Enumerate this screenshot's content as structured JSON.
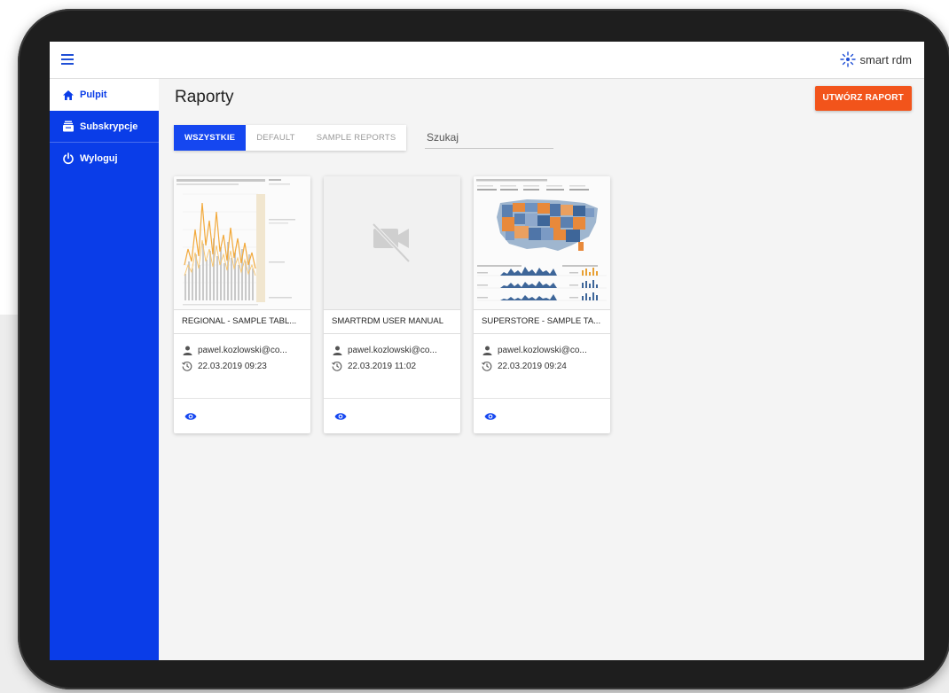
{
  "app": {
    "logo_text": "smart rdm",
    "accent": "#0a3de8",
    "create_color": "#f2541b"
  },
  "sidebar": {
    "items": [
      {
        "label": "Pulpit",
        "icon": "home-icon"
      },
      {
        "label": "Subskrypcje",
        "icon": "subscriptions-icon"
      },
      {
        "label": "Wyloguj",
        "icon": "power-icon"
      }
    ]
  },
  "main": {
    "title": "Raporty",
    "create_label": "UTWÓRZ RAPORT",
    "tabs": [
      {
        "label": "WSZYSTKIE"
      },
      {
        "label": "DEFAULT"
      },
      {
        "label": "SAMPLE REPORTS"
      }
    ],
    "search_placeholder": "Szukaj"
  },
  "cards": [
    {
      "title": "REGIONAL - SAMPLE TABL...",
      "author": "pawel.kozlowski@co...",
      "date": "22.03.2019 09:23",
      "thumb": "line-chart-thumbnail"
    },
    {
      "title": "SMARTRDM USER MANUAL",
      "author": "pawel.kozlowski@co...",
      "date": "22.03.2019 11:02",
      "thumb": "no-video-icon"
    },
    {
      "title": "SUPERSTORE - SAMPLE TA...",
      "author": "pawel.kozlowski@co...",
      "date": "22.03.2019 09:24",
      "thumb": "us-map-dashboard-thumbnail"
    }
  ]
}
